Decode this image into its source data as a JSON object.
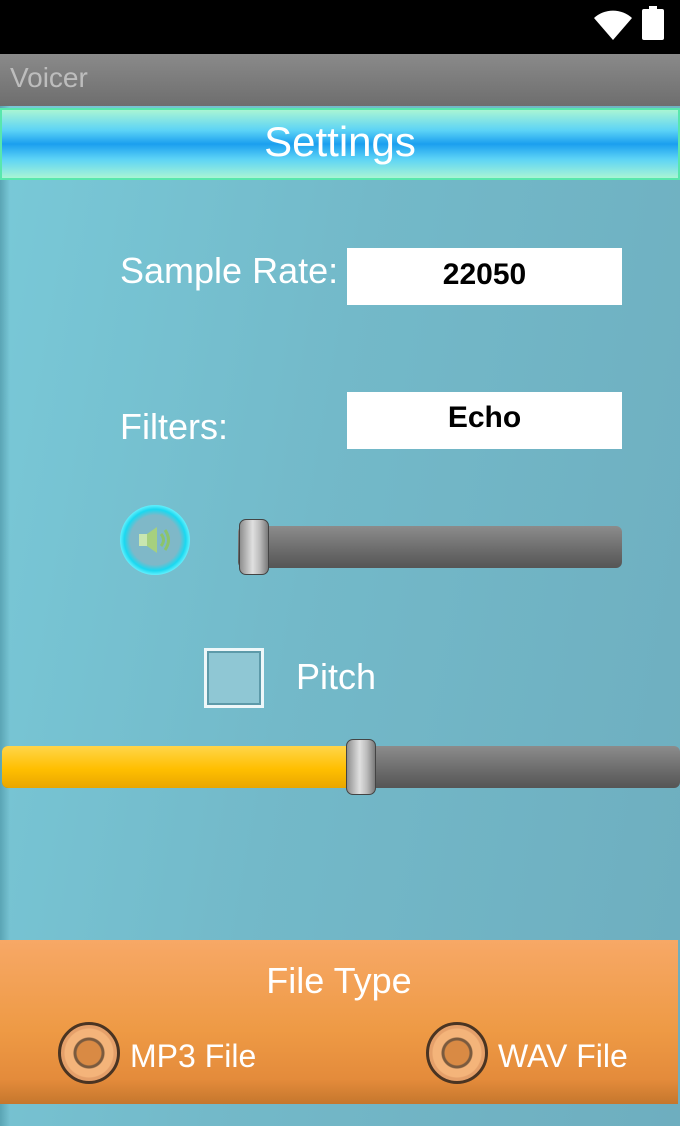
{
  "status_bar": {
    "wifi_icon": "wifi-icon",
    "battery_icon": "battery-icon"
  },
  "app": {
    "title": "Voicer"
  },
  "header": {
    "title": "Settings"
  },
  "sample_rate": {
    "label": "Sample Rate:",
    "value": "22050"
  },
  "filters": {
    "label": "Filters:",
    "value": "Echo"
  },
  "volume": {
    "icon": "speaker-icon",
    "level": 0.0
  },
  "pitch": {
    "label": "Pitch",
    "checked": false,
    "level": 0.53
  },
  "file_type": {
    "title": "File Type",
    "options": [
      {
        "label": "MP3 File",
        "selected": false
      },
      {
        "label": "WAV File",
        "selected": false
      }
    ]
  },
  "colors": {
    "accent_yellow": "#ffbf00",
    "panel_orange": "#ee9a45",
    "background_teal": "#73b9c9",
    "glow_cyan": "#1ad8f0"
  }
}
